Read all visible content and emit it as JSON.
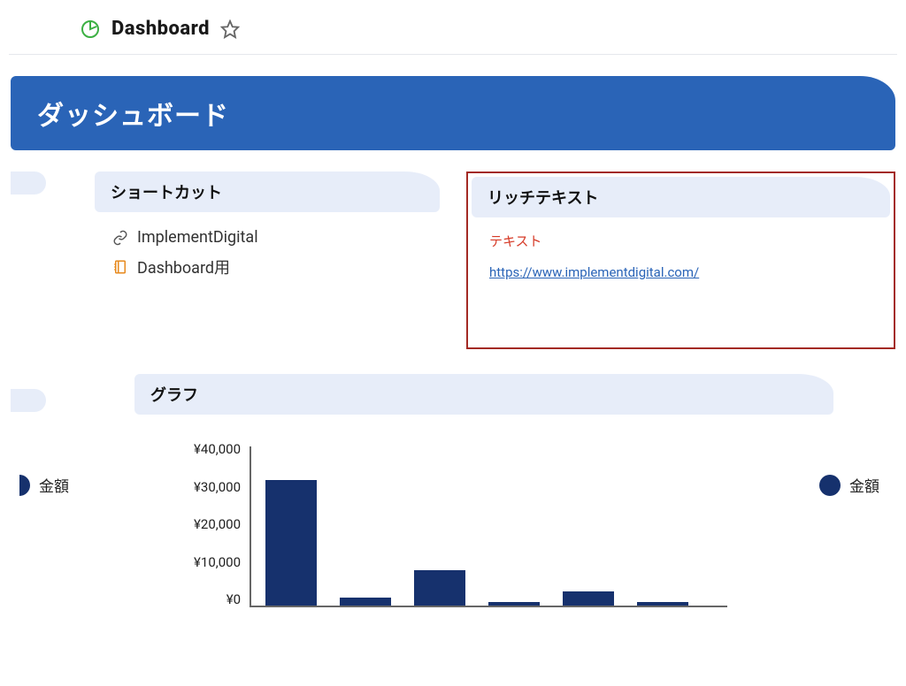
{
  "header": {
    "title": "Dashboard"
  },
  "banner": {
    "title": "ダッシュボード"
  },
  "shortcuts": {
    "title": "ショートカット",
    "items": [
      {
        "label": "ImplementDigital",
        "icon": "link"
      },
      {
        "label": "Dashboard用",
        "icon": "notebook"
      }
    ]
  },
  "richtext": {
    "title": "リッチテキスト",
    "text_label": "テキスト",
    "link_label": "https://www.implementdigital.com/"
  },
  "graph": {
    "title": "グラフ",
    "legend_label": "金額"
  },
  "chart_data": {
    "type": "bar",
    "title": "",
    "xlabel": "",
    "ylabel": "",
    "ylim": [
      0,
      40000
    ],
    "yticks": [
      "¥40,000",
      "¥30,000",
      "¥20,000",
      "¥10,000",
      "¥0"
    ],
    "currency": "¥",
    "series": [
      {
        "name": "金額",
        "values": [
          32000,
          2000,
          9000,
          1000,
          3500,
          1000
        ]
      }
    ]
  }
}
